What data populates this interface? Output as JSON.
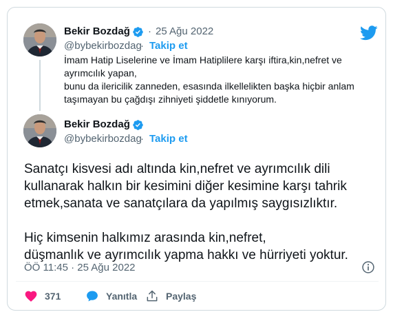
{
  "quoted_tweet": {
    "author_name": "Bekir Bozdağ",
    "separator": "·",
    "date": "25 Ağu 2022",
    "handle": "@bybekirbozdag",
    "handle_separator": "·",
    "follow_label": "Takip et",
    "text_lines": [
      "İmam Hatip Liselerine ve İmam Hatiplilere karşı iftira,kin,nefret ve",
      "ayrımcılık yapan,",
      "bunu da ilericilik zanneden, esasında ilkellelikten başka hiçbir anlam",
      "taşımayan bu çağdışı zihniyeti şiddetle kınıyorum."
    ]
  },
  "main_tweet": {
    "author_name": "Bekir Bozdağ",
    "handle": "@bybekirbozdag",
    "handle_separator": "·",
    "follow_label": "Takip et",
    "paragraphs": [
      [
        "Sanatçı kisvesi adı altında kin,nefret ve ayrımcılık dili",
        "kullanarak halkın bir kesimini diğer kesimine karşı tahrik",
        "etmek,sanata ve sanatçılara da yapılmış saygısızlıktır."
      ],
      [
        "Hiç kimsenin halkımız arasında kin,nefret,",
        "düşmanlık ve ayrımcılık yapma hakkı ve hürriyeti yoktur."
      ]
    ],
    "timestamp": "ÖÖ 11:45 · 25 Ağu 2022"
  },
  "actions": {
    "like_count": "371",
    "reply_label": "Yanıtla",
    "share_label": "Paylaş"
  },
  "icons": {
    "brand": "twitter-bird-icon",
    "verified": "verified-badge-icon",
    "info": "info-icon",
    "like": "heart-icon",
    "reply": "reply-bubble-icon",
    "share": "share-icon"
  },
  "colors": {
    "accent": "#1d9bf0",
    "like": "#f91880",
    "text": "#0f1419",
    "muted": "#536471",
    "border": "#cfd9de"
  }
}
